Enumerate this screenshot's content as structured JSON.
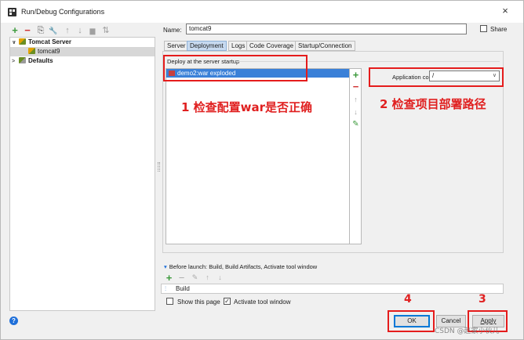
{
  "window": {
    "title": "Run/Debug Configurations",
    "close_glyph": "×"
  },
  "left_toolbar": {
    "add_glyph": "+",
    "remove_glyph": "−",
    "copy_glyph": "⎘",
    "wrench_glyph": "🔧",
    "up_glyph": "↑",
    "down_glyph": "↓",
    "folder_glyph": "▆",
    "sort_glyph": "⇅",
    "add_color": "#3c9a3c",
    "remove_color": "#d03030"
  },
  "tree": {
    "items": [
      {
        "label": "Tomcat Server",
        "expanded": true,
        "caret": "∨"
      },
      {
        "label": "tomcat9",
        "selected": true
      },
      {
        "label": "Defaults",
        "expanded": false,
        "caret": ">"
      }
    ]
  },
  "form": {
    "name_label": "Name:",
    "name_value": "tomcat9",
    "share_label": "Share"
  },
  "tabs": [
    {
      "label": "Server",
      "active": false
    },
    {
      "label": "Deployment",
      "active": true
    },
    {
      "label": "Logs",
      "active": false
    },
    {
      "label": "Code Coverage",
      "active": false
    },
    {
      "label": "Startup/Connection",
      "active": false
    }
  ],
  "deployment": {
    "section_label": "Deploy at the server startup",
    "artifacts": [
      "demo2:war exploded"
    ],
    "add_glyph": "+",
    "remove_glyph": "−",
    "up_glyph": "↑",
    "down_glyph": "↓",
    "edit_glyph": "✎",
    "context_label": "Application context:",
    "context_value": "/",
    "context_caret": "∨"
  },
  "annotations": {
    "note1": "1 检查配置war是否正确",
    "note2": "2 检查项目部署路径",
    "num3": "3",
    "num4": "4",
    "color": "#e02020"
  },
  "before_launch": {
    "label": "Before launch: Build, Build Artifacts, Activate tool window",
    "expand_glyph": "▾",
    "add_glyph": "+",
    "remove_glyph": "−",
    "edit_glyph": "✎",
    "up_glyph": "↑",
    "down_glyph": "↓",
    "tasks": [
      "Build"
    ],
    "build_icon": "⫶",
    "show_page_label": "Show this page",
    "show_page_checked": false,
    "activate_label": "Activate tool window",
    "activate_checked": true,
    "check_glyph": "✓"
  },
  "buttons": {
    "help_glyph": "?",
    "ok": "OK",
    "cancel": "Cancel",
    "apply": "Apply"
  },
  "watermark": "CSDN @赵家小伙儿"
}
